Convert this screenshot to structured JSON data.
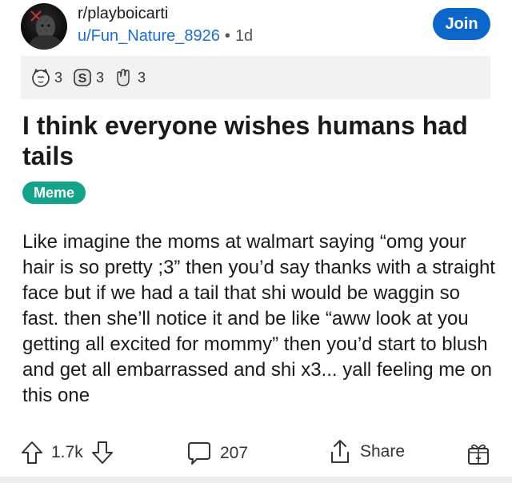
{
  "post": {
    "subreddit": "r/playboicarti",
    "author": "u/Fun_Nature_8926",
    "separator": "•",
    "age": "1d",
    "join_label": "Join",
    "awards": [
      {
        "icon": "cat-face-icon",
        "count": "3"
      },
      {
        "icon": "s-coin-icon",
        "count": "3"
      },
      {
        "icon": "rock-hand-icon",
        "count": "3"
      }
    ],
    "title": "I think everyone wishes humans had tails",
    "flair": "Meme",
    "body": "Like imagine the moms at walmart saying “omg your hair is so pretty ;3” then you’d say thanks with a straight face but if we had a tail that shi would be waggin so fast. then she’ll notice it and be like “aww look at you getting all excited for mommy” then you’d start to blush and get all embarrassed and shi x3... yall feeling me on this one"
  },
  "actions": {
    "score": "1.7k",
    "comments": "207",
    "share_label": "Share"
  },
  "colors": {
    "join_bg": "#0a66c9",
    "author": "#1a6fd1",
    "flair_bg": "#13a38a",
    "awards_bg": "#f2f2f2"
  }
}
